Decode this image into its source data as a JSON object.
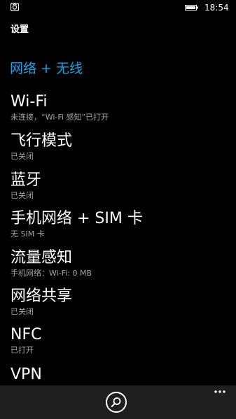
{
  "status_bar": {
    "time": "18:54",
    "app_icon": "notification-app-icon",
    "battery_icon": "battery-icon"
  },
  "page": {
    "title": "设置",
    "section_header": "网络 + 无线"
  },
  "settings": [
    {
      "label": "Wi-Fi",
      "status": "未连接，“Wi-Fi 感知”已打开"
    },
    {
      "label": "飞行模式",
      "status": "已关闭"
    },
    {
      "label": "蓝牙",
      "status": "已关闭"
    },
    {
      "label": "手机网络 + SIM 卡",
      "status": "无 SIM 卡"
    },
    {
      "label": "流量感知",
      "status": "手机网络：Wi-Fi: 0 MB"
    },
    {
      "label": "网络共享",
      "status": "已关闭"
    },
    {
      "label": "NFC",
      "status": "已打开"
    },
    {
      "label": "VPN",
      "status": ""
    }
  ],
  "app_bar": {
    "search_icon": "search-icon",
    "more_icon": "more-ellipsis-icon"
  },
  "colors": {
    "background": "#000000",
    "accent": "#1ba1e2",
    "secondary_text": "#a6a6a6",
    "app_bar": "#1f1f1f"
  }
}
